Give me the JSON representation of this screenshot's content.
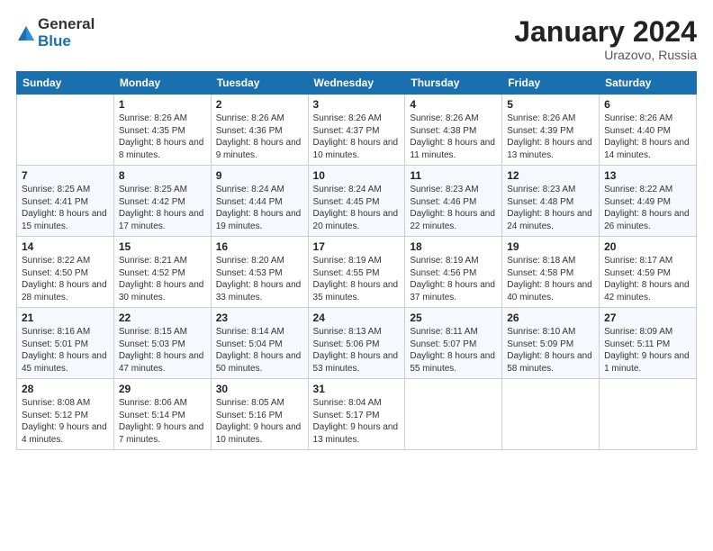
{
  "logo": {
    "general": "General",
    "blue": "Blue"
  },
  "title": "January 2024",
  "location": "Urazovo, Russia",
  "days_of_week": [
    "Sunday",
    "Monday",
    "Tuesday",
    "Wednesday",
    "Thursday",
    "Friday",
    "Saturday"
  ],
  "weeks": [
    [
      {
        "day": "",
        "sunrise": "",
        "sunset": "",
        "daylight": ""
      },
      {
        "day": "1",
        "sunrise": "Sunrise: 8:26 AM",
        "sunset": "Sunset: 4:35 PM",
        "daylight": "Daylight: 8 hours and 8 minutes."
      },
      {
        "day": "2",
        "sunrise": "Sunrise: 8:26 AM",
        "sunset": "Sunset: 4:36 PM",
        "daylight": "Daylight: 8 hours and 9 minutes."
      },
      {
        "day": "3",
        "sunrise": "Sunrise: 8:26 AM",
        "sunset": "Sunset: 4:37 PM",
        "daylight": "Daylight: 8 hours and 10 minutes."
      },
      {
        "day": "4",
        "sunrise": "Sunrise: 8:26 AM",
        "sunset": "Sunset: 4:38 PM",
        "daylight": "Daylight: 8 hours and 11 minutes."
      },
      {
        "day": "5",
        "sunrise": "Sunrise: 8:26 AM",
        "sunset": "Sunset: 4:39 PM",
        "daylight": "Daylight: 8 hours and 13 minutes."
      },
      {
        "day": "6",
        "sunrise": "Sunrise: 8:26 AM",
        "sunset": "Sunset: 4:40 PM",
        "daylight": "Daylight: 8 hours and 14 minutes."
      }
    ],
    [
      {
        "day": "7",
        "sunrise": "Sunrise: 8:25 AM",
        "sunset": "Sunset: 4:41 PM",
        "daylight": "Daylight: 8 hours and 15 minutes."
      },
      {
        "day": "8",
        "sunrise": "Sunrise: 8:25 AM",
        "sunset": "Sunset: 4:42 PM",
        "daylight": "Daylight: 8 hours and 17 minutes."
      },
      {
        "day": "9",
        "sunrise": "Sunrise: 8:24 AM",
        "sunset": "Sunset: 4:44 PM",
        "daylight": "Daylight: 8 hours and 19 minutes."
      },
      {
        "day": "10",
        "sunrise": "Sunrise: 8:24 AM",
        "sunset": "Sunset: 4:45 PM",
        "daylight": "Daylight: 8 hours and 20 minutes."
      },
      {
        "day": "11",
        "sunrise": "Sunrise: 8:23 AM",
        "sunset": "Sunset: 4:46 PM",
        "daylight": "Daylight: 8 hours and 22 minutes."
      },
      {
        "day": "12",
        "sunrise": "Sunrise: 8:23 AM",
        "sunset": "Sunset: 4:48 PM",
        "daylight": "Daylight: 8 hours and 24 minutes."
      },
      {
        "day": "13",
        "sunrise": "Sunrise: 8:22 AM",
        "sunset": "Sunset: 4:49 PM",
        "daylight": "Daylight: 8 hours and 26 minutes."
      }
    ],
    [
      {
        "day": "14",
        "sunrise": "Sunrise: 8:22 AM",
        "sunset": "Sunset: 4:50 PM",
        "daylight": "Daylight: 8 hours and 28 minutes."
      },
      {
        "day": "15",
        "sunrise": "Sunrise: 8:21 AM",
        "sunset": "Sunset: 4:52 PM",
        "daylight": "Daylight: 8 hours and 30 minutes."
      },
      {
        "day": "16",
        "sunrise": "Sunrise: 8:20 AM",
        "sunset": "Sunset: 4:53 PM",
        "daylight": "Daylight: 8 hours and 33 minutes."
      },
      {
        "day": "17",
        "sunrise": "Sunrise: 8:19 AM",
        "sunset": "Sunset: 4:55 PM",
        "daylight": "Daylight: 8 hours and 35 minutes."
      },
      {
        "day": "18",
        "sunrise": "Sunrise: 8:19 AM",
        "sunset": "Sunset: 4:56 PM",
        "daylight": "Daylight: 8 hours and 37 minutes."
      },
      {
        "day": "19",
        "sunrise": "Sunrise: 8:18 AM",
        "sunset": "Sunset: 4:58 PM",
        "daylight": "Daylight: 8 hours and 40 minutes."
      },
      {
        "day": "20",
        "sunrise": "Sunrise: 8:17 AM",
        "sunset": "Sunset: 4:59 PM",
        "daylight": "Daylight: 8 hours and 42 minutes."
      }
    ],
    [
      {
        "day": "21",
        "sunrise": "Sunrise: 8:16 AM",
        "sunset": "Sunset: 5:01 PM",
        "daylight": "Daylight: 8 hours and 45 minutes."
      },
      {
        "day": "22",
        "sunrise": "Sunrise: 8:15 AM",
        "sunset": "Sunset: 5:03 PM",
        "daylight": "Daylight: 8 hours and 47 minutes."
      },
      {
        "day": "23",
        "sunrise": "Sunrise: 8:14 AM",
        "sunset": "Sunset: 5:04 PM",
        "daylight": "Daylight: 8 hours and 50 minutes."
      },
      {
        "day": "24",
        "sunrise": "Sunrise: 8:13 AM",
        "sunset": "Sunset: 5:06 PM",
        "daylight": "Daylight: 8 hours and 53 minutes."
      },
      {
        "day": "25",
        "sunrise": "Sunrise: 8:11 AM",
        "sunset": "Sunset: 5:07 PM",
        "daylight": "Daylight: 8 hours and 55 minutes."
      },
      {
        "day": "26",
        "sunrise": "Sunrise: 8:10 AM",
        "sunset": "Sunset: 5:09 PM",
        "daylight": "Daylight: 8 hours and 58 minutes."
      },
      {
        "day": "27",
        "sunrise": "Sunrise: 8:09 AM",
        "sunset": "Sunset: 5:11 PM",
        "daylight": "Daylight: 9 hours and 1 minute."
      }
    ],
    [
      {
        "day": "28",
        "sunrise": "Sunrise: 8:08 AM",
        "sunset": "Sunset: 5:12 PM",
        "daylight": "Daylight: 9 hours and 4 minutes."
      },
      {
        "day": "29",
        "sunrise": "Sunrise: 8:06 AM",
        "sunset": "Sunset: 5:14 PM",
        "daylight": "Daylight: 9 hours and 7 minutes."
      },
      {
        "day": "30",
        "sunrise": "Sunrise: 8:05 AM",
        "sunset": "Sunset: 5:16 PM",
        "daylight": "Daylight: 9 hours and 10 minutes."
      },
      {
        "day": "31",
        "sunrise": "Sunrise: 8:04 AM",
        "sunset": "Sunset: 5:17 PM",
        "daylight": "Daylight: 9 hours and 13 minutes."
      },
      {
        "day": "",
        "sunrise": "",
        "sunset": "",
        "daylight": ""
      },
      {
        "day": "",
        "sunrise": "",
        "sunset": "",
        "daylight": ""
      },
      {
        "day": "",
        "sunrise": "",
        "sunset": "",
        "daylight": ""
      }
    ]
  ]
}
